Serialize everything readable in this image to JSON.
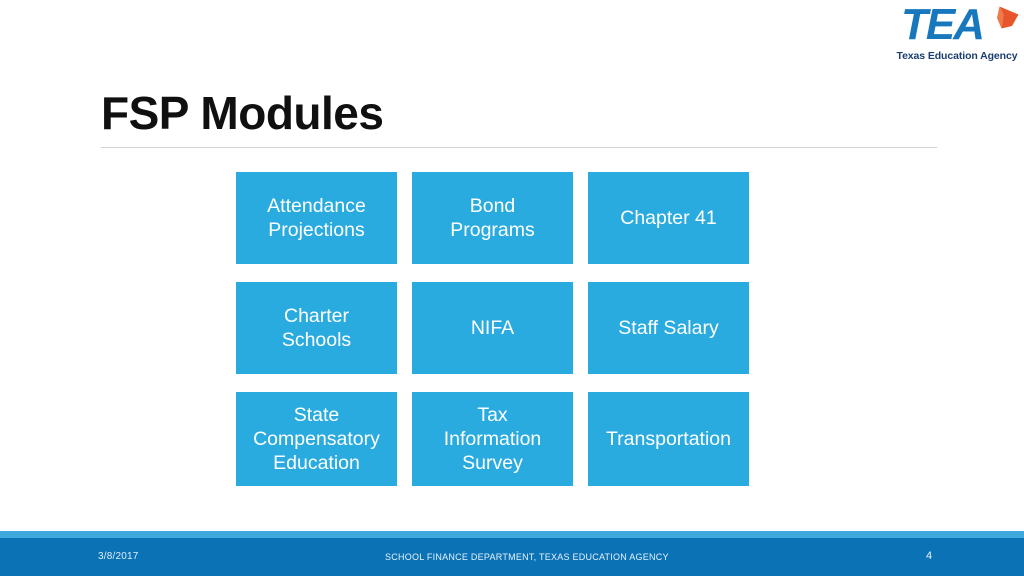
{
  "slide": {
    "background_color": "#ffffff",
    "title": "FSP Modules"
  },
  "logo": {
    "wordmark": "TEA",
    "subtitle": "Texas Education Agency",
    "mark_color": "#1878BE",
    "cap_color": "#E8552A",
    "subtitle_color": "#1B3E6F",
    "cap_icon": "graduation-cap-icon"
  },
  "modules": [
    {
      "label": "Attendance\nProjections"
    },
    {
      "label": "Bond\nPrograms"
    },
    {
      "label": "Chapter 41"
    },
    {
      "label": "Charter\nSchools"
    },
    {
      "label": "NIFA"
    },
    {
      "label": "Staff Salary"
    },
    {
      "label": "State\nCompensatory\nEducation"
    },
    {
      "label": "Tax\nInformation\nSurvey"
    },
    {
      "label": "Transportation"
    }
  ],
  "module_style": {
    "fill_color": "#29ABE0",
    "text_color": "#ffffff"
  },
  "footer": {
    "date": "3/8/2017",
    "center_text": "SCHOOL FINANCE DEPARTMENT, TEXAS EDUCATION AGENCY",
    "page_number": "4",
    "strip_color": "#3FA8DC",
    "bar_color": "#0B72B5"
  }
}
